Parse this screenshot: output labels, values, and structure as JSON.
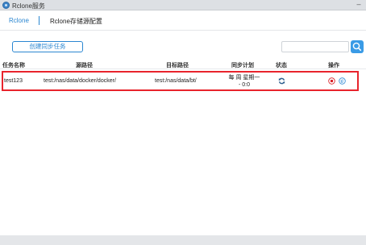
{
  "window": {
    "title": "Rclone服务",
    "minimize_label": "–"
  },
  "tabs": [
    {
      "label": "Rclone",
      "active": true
    },
    {
      "label": "Rclone存储源配置",
      "active": false
    }
  ],
  "toolbar": {
    "create_label": "创建同步任务",
    "search_placeholder": ""
  },
  "table": {
    "headers": [
      "任务名称",
      "源路径",
      "目标路径",
      "同步计划",
      "状态",
      "操作"
    ],
    "rows": [
      {
        "name": "test123",
        "source": "test:/nas/data/docker/docker/",
        "target": "test:/nas/data/bt/",
        "schedule_line1": "每 周 星期一",
        "schedule_line2": "- 0:0",
        "status_icon": "sync-icon",
        "actions": [
          "stop-icon",
          "log-icon"
        ]
      }
    ]
  },
  "colors": {
    "accent": "#2b87d1",
    "highlight_border": "#e8242c",
    "search_button": "#3a9be6"
  }
}
